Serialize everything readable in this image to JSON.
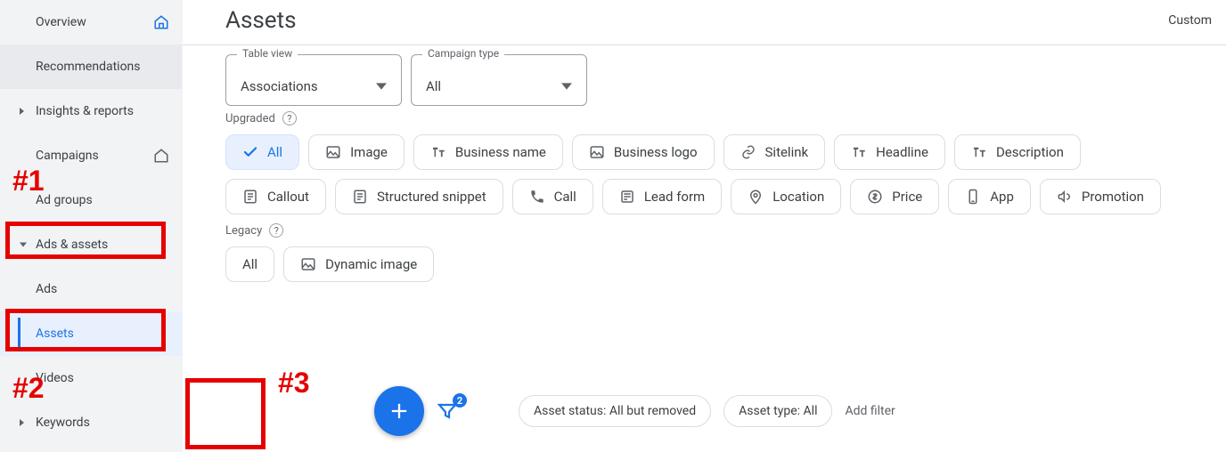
{
  "sidebar": {
    "items": [
      {
        "label": "Overview"
      },
      {
        "label": "Recommendations"
      },
      {
        "label": "Insights & reports"
      },
      {
        "label": "Campaigns"
      },
      {
        "label": "Ad groups"
      },
      {
        "label": "Ads & assets"
      },
      {
        "label": "Ads"
      },
      {
        "label": "Assets"
      },
      {
        "label": "Videos"
      },
      {
        "label": "Keywords"
      }
    ]
  },
  "header": {
    "title": "Assets",
    "custom": "Custom"
  },
  "controls": {
    "table_view": {
      "legend": "Table view",
      "value": "Associations"
    },
    "campaign_type": {
      "legend": "Campaign type",
      "value": "All"
    }
  },
  "sections": {
    "upgraded": "Upgraded",
    "legacy": "Legacy"
  },
  "upgraded_chips": {
    "all": "All",
    "image": "Image",
    "business_name": "Business name",
    "business_logo": "Business logo",
    "sitelink": "Sitelink",
    "headline": "Headline",
    "description": "Description",
    "callout": "Callout",
    "structured_snippet": "Structured snippet",
    "call": "Call",
    "lead_form": "Lead form",
    "location": "Location",
    "price": "Price",
    "app": "App",
    "promotion": "Promotion"
  },
  "legacy_chips": {
    "all": "All",
    "dynamic_image": "Dynamic image"
  },
  "filterbar": {
    "badge": "2",
    "status": "Asset status: All but removed",
    "type": "Asset type: All",
    "add": "Add filter"
  },
  "annotations": {
    "one": "#1",
    "two": "#2",
    "three": "#3"
  }
}
